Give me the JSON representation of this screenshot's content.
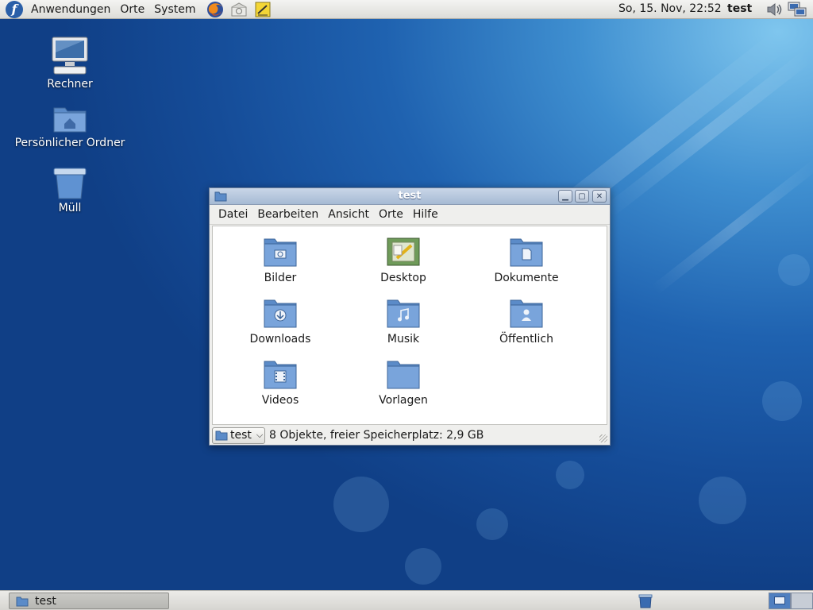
{
  "top_panel": {
    "menus": [
      "Anwendungen",
      "Orte",
      "System"
    ],
    "launchers": [
      "firefox-icon",
      "mail-icon",
      "notes-icon"
    ],
    "clock": "So, 15. Nov, 22:52",
    "user": "test",
    "tray": [
      "volume-icon",
      "network-icon"
    ]
  },
  "desktop": {
    "icons": [
      {
        "label": "Rechner",
        "icon": "computer-icon"
      },
      {
        "label": "Persönlicher Ordner",
        "icon": "home-folder-icon"
      },
      {
        "label": "Müll",
        "icon": "trash-icon"
      }
    ]
  },
  "window": {
    "title": "test",
    "menu": [
      "Datei",
      "Bearbeiten",
      "Ansicht",
      "Orte",
      "Hilfe"
    ],
    "files": [
      {
        "label": "Bilder",
        "icon": "pictures-folder-icon"
      },
      {
        "label": "Desktop",
        "icon": "desktop-folder-icon"
      },
      {
        "label": "Dokumente",
        "icon": "documents-folder-icon"
      },
      {
        "label": "Downloads",
        "icon": "downloads-folder-icon"
      },
      {
        "label": "Musik",
        "icon": "music-folder-icon"
      },
      {
        "label": "Öffentlich",
        "icon": "public-folder-icon"
      },
      {
        "label": "Videos",
        "icon": "videos-folder-icon"
      },
      {
        "label": "Vorlagen",
        "icon": "templates-folder-icon"
      }
    ],
    "location": "test",
    "status": "8 Objekte, freier Speicherplatz: 2,9 GB"
  },
  "taskbar": {
    "task": "test"
  },
  "colors": {
    "folder": "#6e9cd6",
    "desktop_bg": "#1f62b0"
  }
}
